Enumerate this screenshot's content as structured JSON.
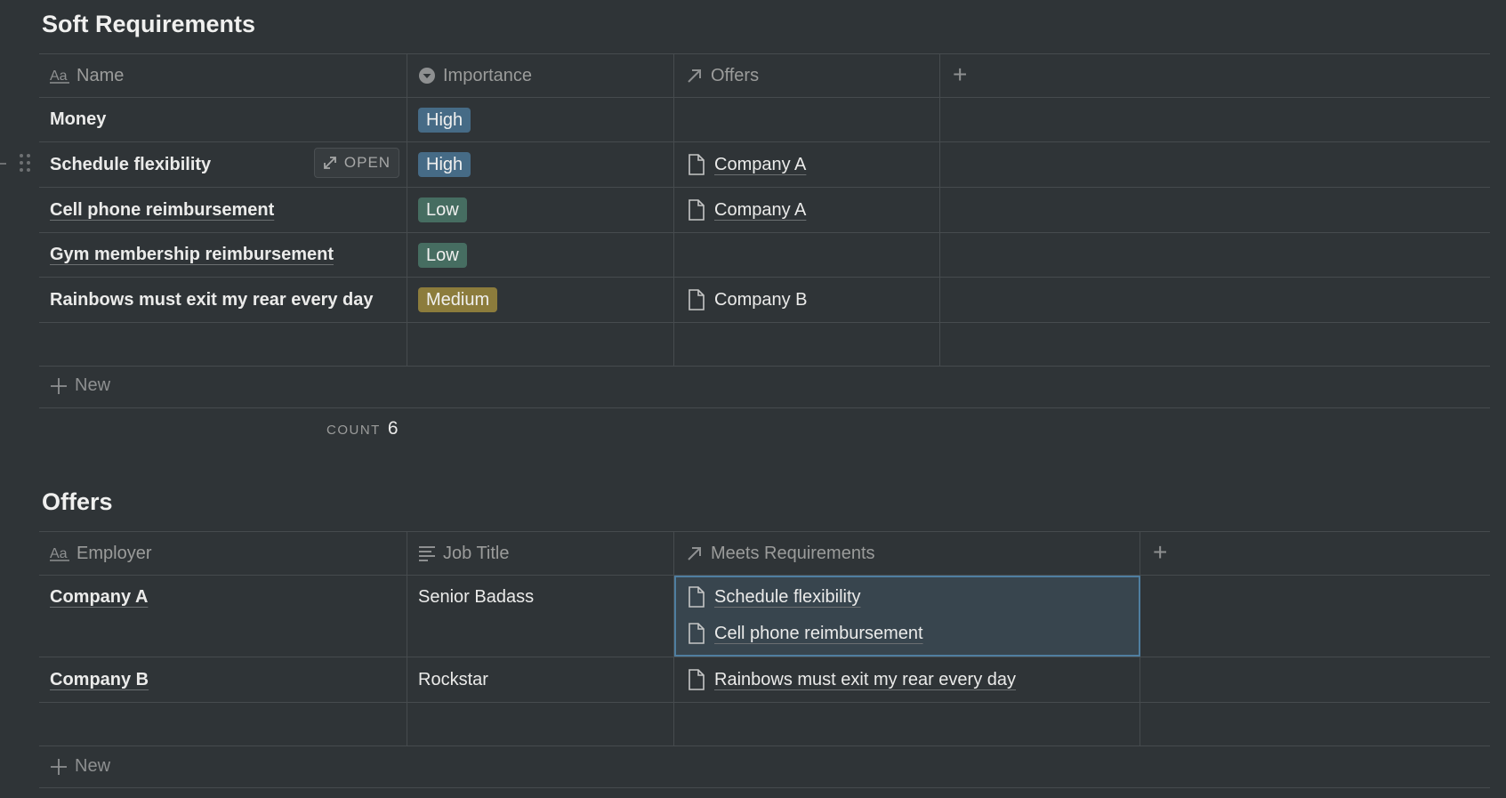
{
  "soft_requirements": {
    "title": "Soft Requirements",
    "columns": [
      "Name",
      "Importance",
      "Offers"
    ],
    "rows": [
      {
        "name": "Money",
        "importance": "High",
        "offers": ""
      },
      {
        "name": "Schedule flexibility",
        "importance": "High",
        "offers": "Company A"
      },
      {
        "name": "Cell phone reimbursement",
        "importance": "Low",
        "offers": "Company A"
      },
      {
        "name": "Gym membership reimbursement",
        "importance": "Low",
        "offers": ""
      },
      {
        "name": "Rainbows must exit my rear every day",
        "importance": "Medium",
        "offers": "Company B"
      }
    ],
    "open_button": "OPEN",
    "new_label": "New",
    "count_label": "COUNT",
    "count_value": "6"
  },
  "offers": {
    "title": "Offers",
    "columns": [
      "Employer",
      "Job Title",
      "Meets Requirements"
    ],
    "rows": [
      {
        "employer": "Company A",
        "job_title": "Senior Badass",
        "meets": [
          "Schedule flexibility",
          "Cell phone reimbursement"
        ]
      },
      {
        "employer": "Company B",
        "job_title": "Rockstar",
        "meets": [
          "Rainbows must exit my rear every day"
        ]
      }
    ],
    "new_label": "New"
  },
  "colors": {
    "background": "#2f3437",
    "tag_high": "#466b86",
    "tag_low": "#466d61",
    "tag_medium": "#8c7c3c",
    "selection_border": "#4f7ea0"
  },
  "icons": [
    "text-aa-icon",
    "select-circle-icon",
    "relation-arrow-icon",
    "add-column-icon",
    "page-icon",
    "open-expand-icon",
    "drag-handle-icon",
    "text-lines-icon",
    "new-plus-icon"
  ]
}
